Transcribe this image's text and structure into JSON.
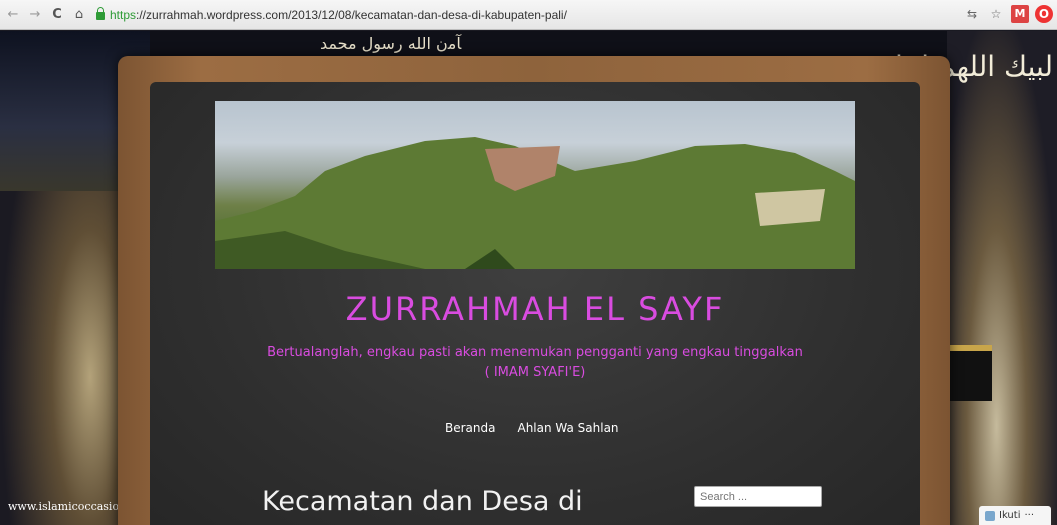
{
  "browser": {
    "nav_back": "←",
    "nav_forward": "→",
    "nav_reload": "C",
    "nav_home": "⌂",
    "url_scheme": "https",
    "url_rest": "://zurrahmah.wordpress.com/2013/12/08/kecamatan-dan-desa-di-kabupaten-pali/",
    "ext_icons": [
      "translate-icon",
      "star-icon",
      "gmail-icon",
      "opera-icon"
    ]
  },
  "background": {
    "calligraphy_top": "ﺂﻣﻥ ﺍﻟﻠﻪ ﺭﺳﻮﻝ ﻣﺤﻤﺪ",
    "calligraphy_right": "لبيك اللهم لبيك",
    "watermark": "www.islamicoccasio"
  },
  "site": {
    "title": "ZURRAHMAH EL SAYF",
    "tagline_line1": "Bertualanglah, engkau pasti akan menemukan pengganti yang engkau tinggalkan",
    "tagline_line2": "( IMAM SYAFI'E)",
    "menu": [
      "Beranda",
      "Ahlan Wa Sahlan"
    ],
    "post_title": "Kecamatan dan Desa di",
    "search_placeholder": "Search ..."
  },
  "follow": {
    "label": "Ikuti",
    "more": "···"
  },
  "colors": {
    "accent": "#d94ce0",
    "board": "#2f2f2f",
    "frame": "#8e633c"
  }
}
